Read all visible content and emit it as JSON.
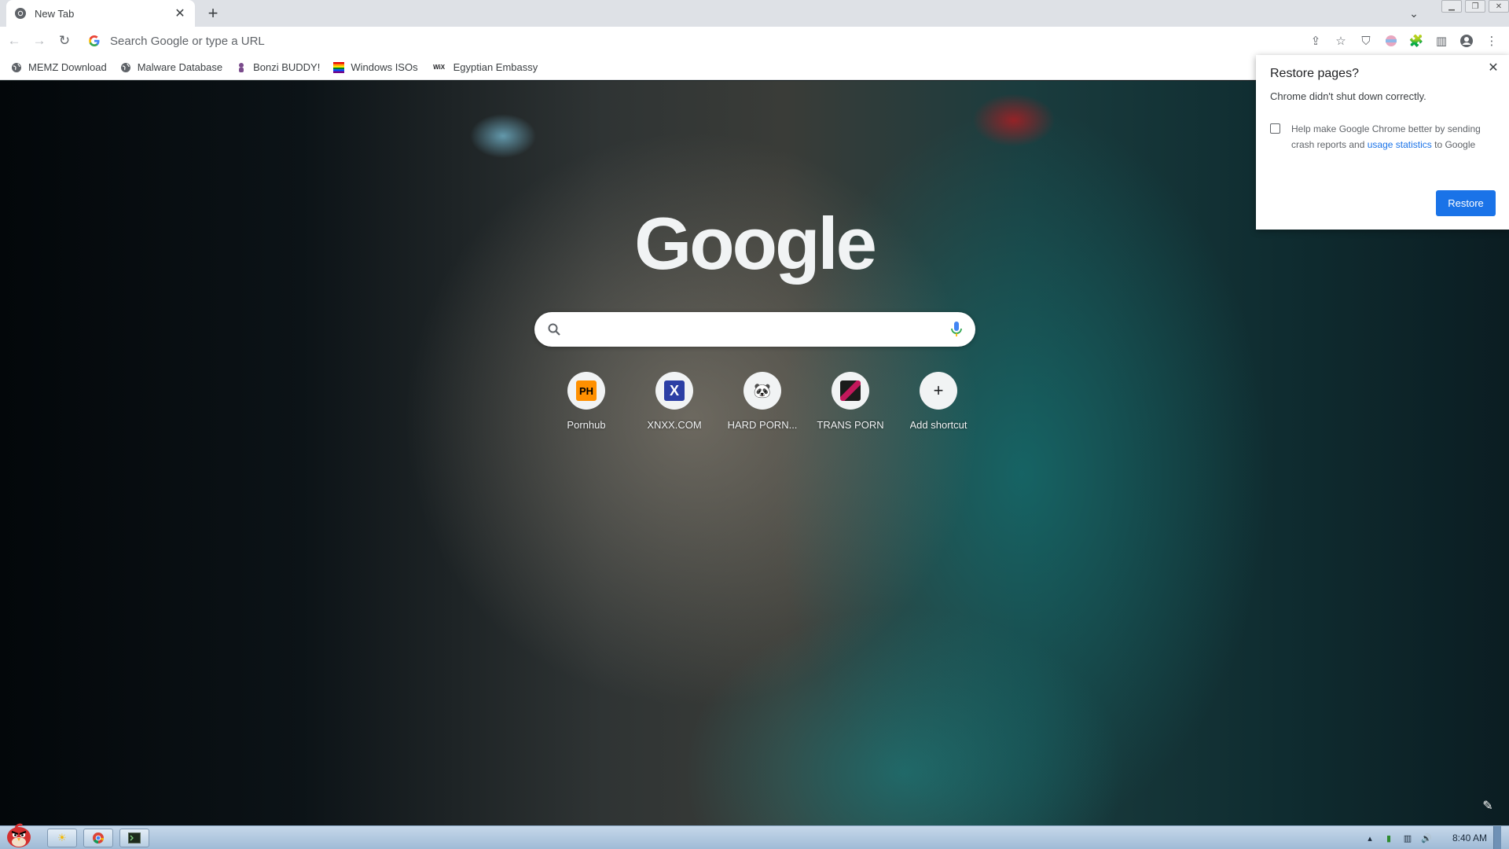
{
  "tab": {
    "title": "New Tab"
  },
  "omnibox": {
    "placeholder": "Search Google or type a URL"
  },
  "bookmarks": [
    {
      "label": "MEMZ Download",
      "icon": "globe-icon"
    },
    {
      "label": "Malware Database",
      "icon": "globe-icon"
    },
    {
      "label": "Bonzi BUDDY!",
      "icon": "bonzi-icon"
    },
    {
      "label": "Windows ISOs",
      "icon": "rainbow-icon"
    },
    {
      "label": "Egyptian Embassy",
      "icon": "wix-icon"
    }
  ],
  "bookmark_wix_text": "WiX",
  "google": {
    "logo": "Google"
  },
  "search": {
    "placeholder": ""
  },
  "shortcuts": [
    {
      "label": "Pornhub",
      "glyph": "PH"
    },
    {
      "label": "XNXX.COM",
      "glyph": "X"
    },
    {
      "label": "HARD PORN...",
      "glyph": "🐼"
    },
    {
      "label": "TRANS PORN",
      "glyph": ""
    },
    {
      "label": "Add shortcut",
      "glyph": "+"
    }
  ],
  "restore": {
    "title": "Restore pages?",
    "message": "Chrome didn't shut down correctly.",
    "help_text": "Help make Google Chrome better by sending crash reports and",
    "help_link": "usage statistics",
    "help_suffix": "to Google",
    "button": "Restore"
  },
  "taskbar": {
    "clock": "8:40 AM"
  },
  "colors": {
    "accent": "#1a73e8",
    "taskbar": "#b7cde2"
  }
}
